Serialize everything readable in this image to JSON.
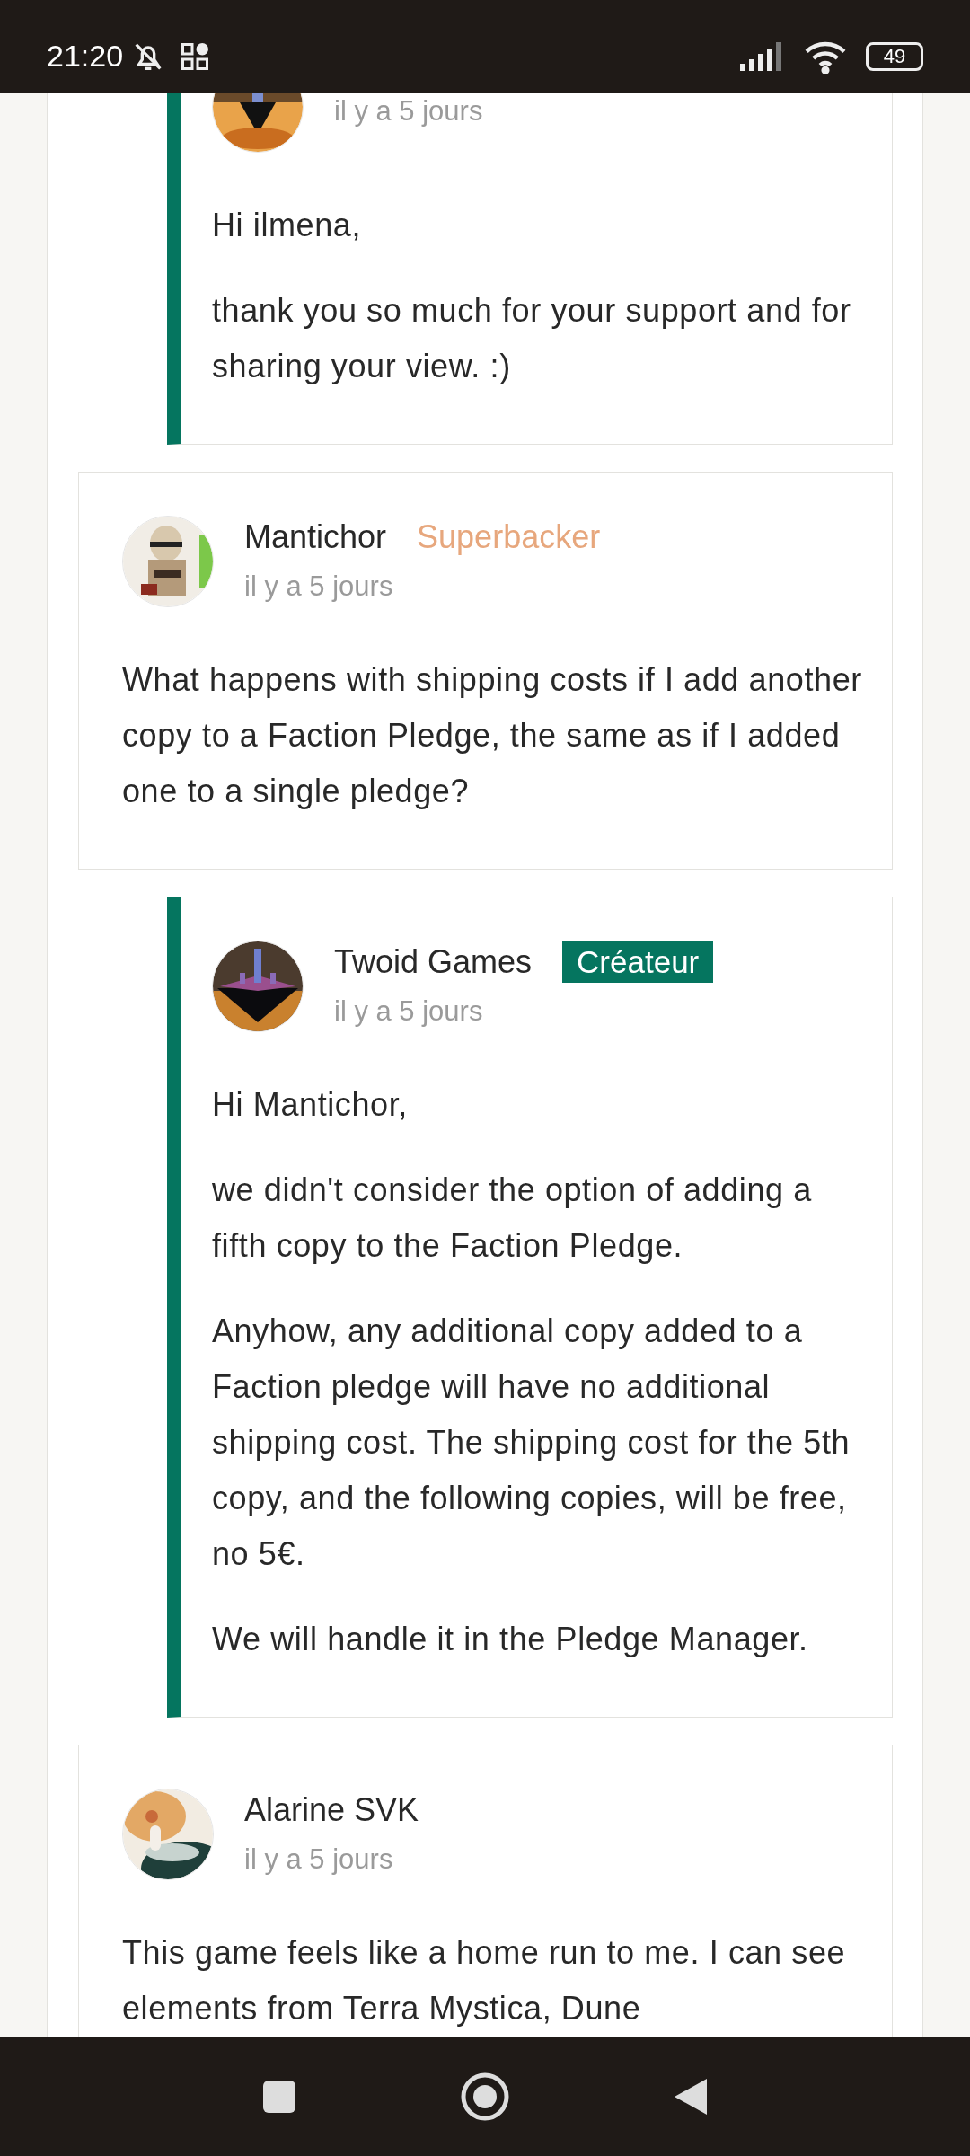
{
  "status_bar": {
    "time": "21:20",
    "battery": "49"
  },
  "comments": [
    {
      "kind": "reply",
      "date": "il y a 5 jours",
      "paragraphs": [
        "Hi ilmena,",
        "thank you so much for your support and for sharing your view. :)"
      ]
    },
    {
      "kind": "comment",
      "author": "Mantichor",
      "badge": {
        "kind": "superbacker",
        "label": "Superbacker"
      },
      "date": "il y a 5 jours",
      "paragraphs": [
        "What happens with shipping costs if I add another copy to a Faction Pledge, the same as if I added one to a single pledge?"
      ]
    },
    {
      "kind": "reply",
      "author": "Twoid Games",
      "badge": {
        "kind": "creator",
        "label": "Créateur"
      },
      "date": "il y a 5 jours",
      "paragraphs": [
        "Hi Mantichor,",
        "we didn't consider the option of adding a fifth copy to the Faction Pledge.",
        "Anyhow, any additional copy added to a Faction pledge will have no additional shipping cost. The shipping cost for the 5th copy, and the following copies, will be free, no 5€.",
        "We will handle it in the Pledge Manager."
      ]
    },
    {
      "kind": "comment",
      "author": "Alarine SVK",
      "date": "il y a 5 jours",
      "paragraphs": [
        "This game feels like a home run to me. I can see elements from Terra Mystica, Dune"
      ]
    }
  ]
}
